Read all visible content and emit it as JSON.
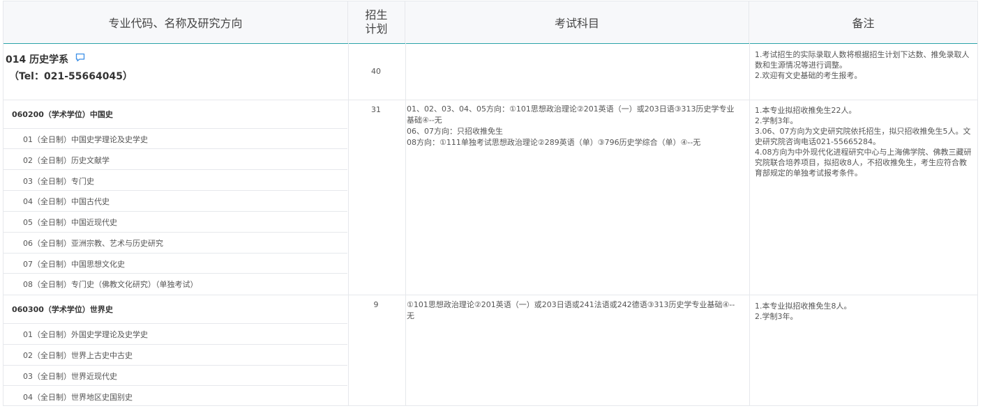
{
  "header": {
    "col_major": "专业代码、名称及研究方向",
    "col_plan_line1": "招生",
    "col_plan_line2": "计划",
    "col_subjects": "考试科目",
    "col_notes": "备注"
  },
  "dept": {
    "name": "014 历史学系",
    "tel": "（Tel：021-55664045）",
    "plan": "40",
    "notes": [
      "1.考试招生的实际录取人数将根据招生计划下达数、推免录取人",
      "数和生源情况等进行调整。",
      "2.欢迎有文史基础的考生报考。"
    ],
    "icon": "chat-bubble-icon"
  },
  "majors": [
    {
      "title": "060200（学术学位）中国史",
      "plan": "31",
      "directions": [
        "01（全日制）中国史学理论及史学史",
        "02（全日制）历史文献学",
        "03（全日制）专门史",
        "04（全日制）中国古代史",
        "05（全日制）中国近现代史",
        "06（全日制）亚洲宗教、艺术与历史研究",
        "07（全日制）中国思想文化史",
        "08（全日制）专门史（佛教文化研究）（单独考试）"
      ],
      "subjects": [
        "01、02、03、04、05方向：①101思想政治理论②201英语（一）或203日语③313历史学专业",
        "基础④--无",
        "06、07方向：只招收推免生",
        "08方向：①111单独考试思想政治理论②289英语（单）③796历史学综合（单）④--无"
      ],
      "notes": [
        "1.本专业拟招收推免生22人。",
        "2.学制3年。",
        "3.06、07方向为文史研究院依托招生，拟只招收推免生5人。文",
        "史研究院咨询电话021-55665284。",
        "4.08方向为中外现代化进程研究中心与上海佛学院、佛教三藏研",
        "究院联合培养项目，拟招收8人，不招收推免生，考生应符合教",
        "育部规定的单独考试报考条件。"
      ]
    },
    {
      "title": "060300（学术学位）世界史",
      "plan": "9",
      "directions": [
        "01（全日制）外国史学理论及史学史",
        "02（全日制）世界上古史中古史",
        "03（全日制）世界近现代史",
        "04（全日制）世界地区史国别史"
      ],
      "subjects": [
        "①101思想政治理论②201英语（一）或203日语或241法语或242德语③313历史学专业基础④--",
        "无"
      ],
      "notes": [
        "1.本专业拟招收推免生8人。",
        "2.学制3年。"
      ]
    }
  ]
}
